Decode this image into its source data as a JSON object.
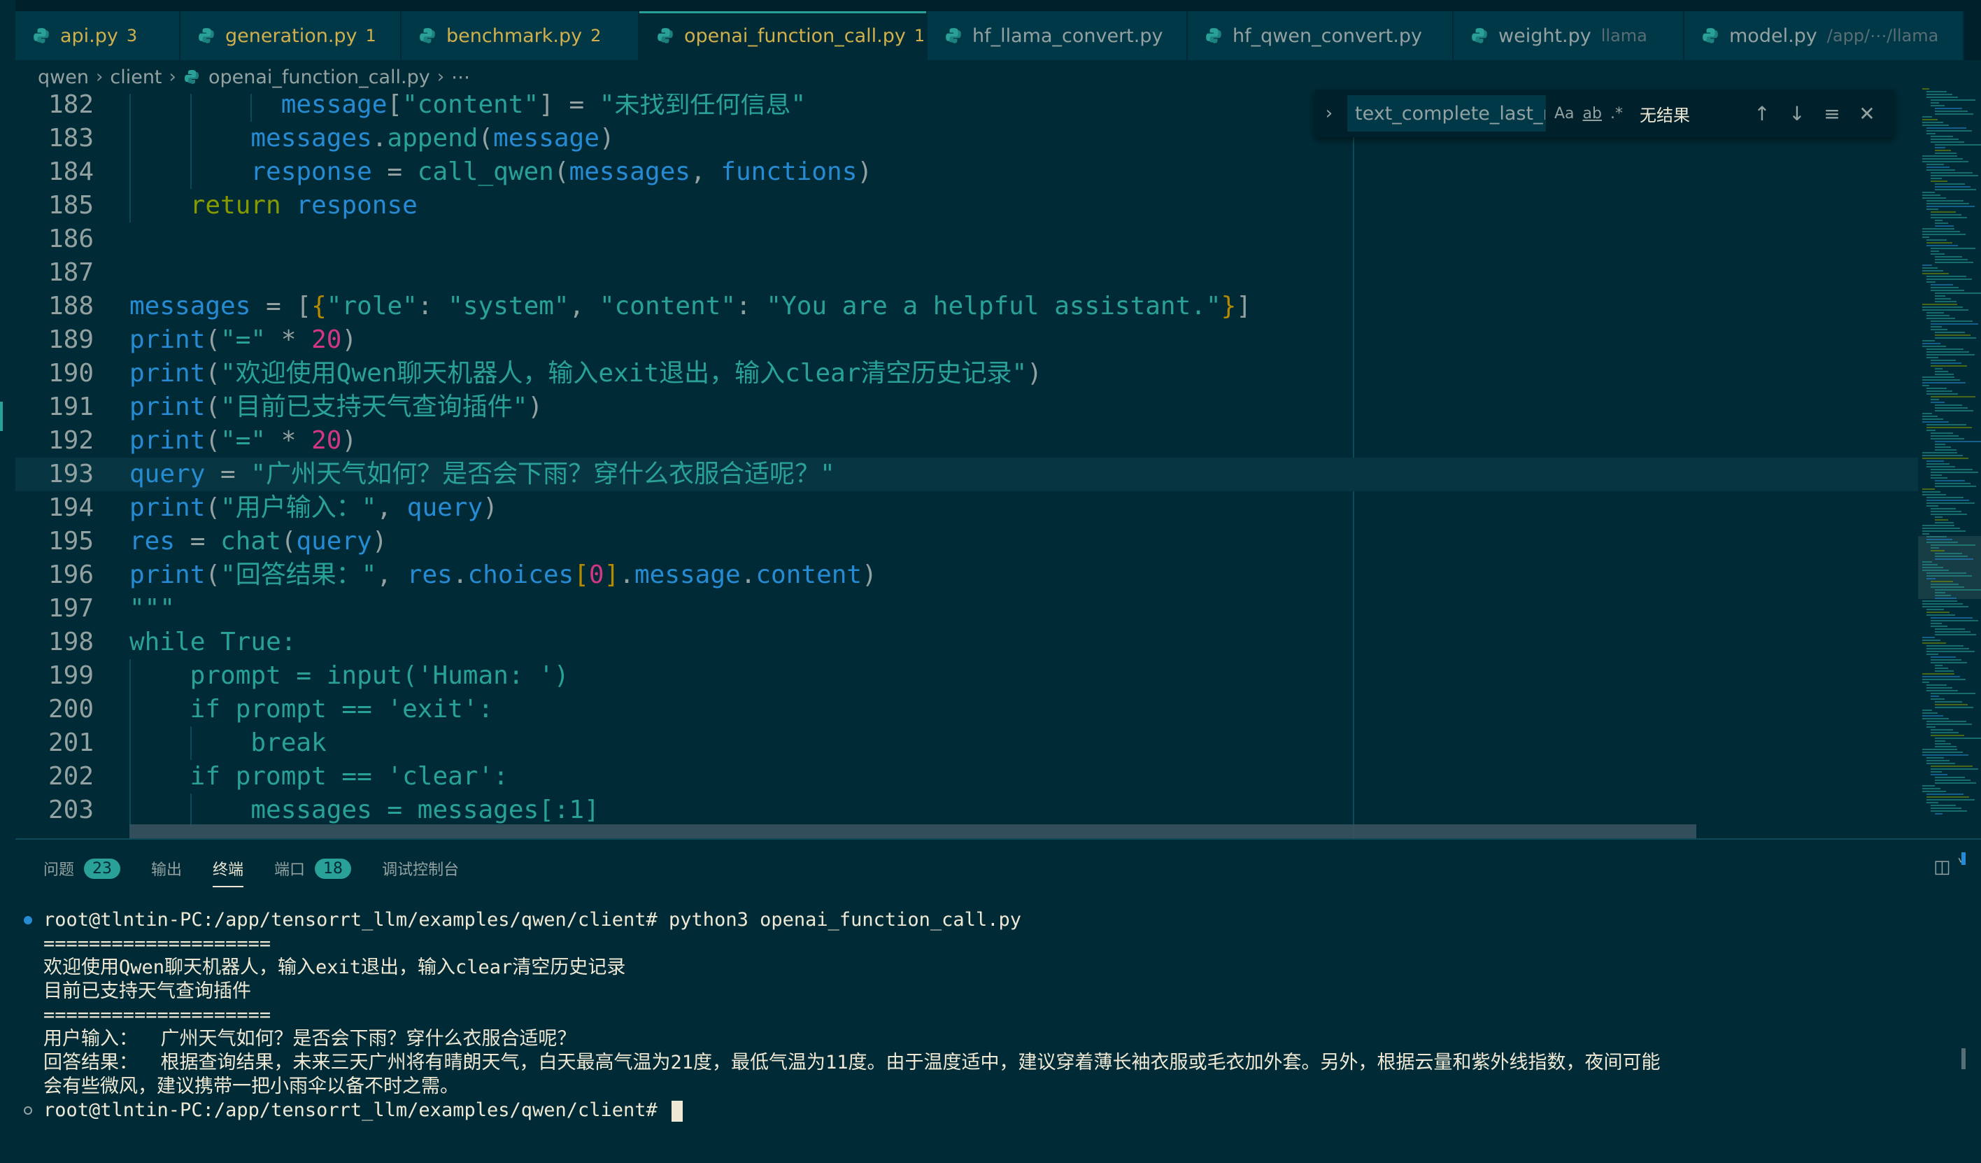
{
  "tabs": [
    {
      "label": "api.py",
      "badge": "3",
      "desc": "",
      "active": false
    },
    {
      "label": "generation.py",
      "badge": "1",
      "desc": "",
      "active": false
    },
    {
      "label": "benchmark.py",
      "badge": "2",
      "desc": "",
      "active": false
    },
    {
      "label": "openai_function_call.py",
      "badge": "1",
      "desc": "",
      "active": true
    },
    {
      "label": "hf_llama_convert.py",
      "badge": "",
      "desc": "",
      "active": false
    },
    {
      "label": "hf_qwen_convert.py",
      "badge": "",
      "desc": "",
      "active": false
    },
    {
      "label": "weight.py",
      "badge": "",
      "desc": "llama",
      "active": false
    },
    {
      "label": "model.py",
      "badge": "",
      "desc": "/app/⋯/llama",
      "active": false
    }
  ],
  "close_glyph": "✕",
  "breadcrumb": {
    "items": [
      "qwen",
      "client",
      "openai_function_call.py"
    ],
    "more": "⋯"
  },
  "find": {
    "query": "text_complete_last_m",
    "match_case": "Aa",
    "whole_word": "ab",
    "regex": ".*",
    "results": "无结果"
  },
  "editor": {
    "lines": [
      {
        "n": "182",
        "tokens": [
          [
            "message",
            "t-var"
          ],
          [
            "[",
            "t-punct"
          ],
          [
            "\"content\"",
            "t-str"
          ],
          [
            "] = ",
            "t-punct"
          ],
          [
            "\"未找到任何信息\"",
            "t-str"
          ]
        ],
        "indent": 10
      },
      {
        "n": "183",
        "tokens": [
          [
            "messages",
            "t-var"
          ],
          [
            ".",
            "t-punct"
          ],
          [
            "append",
            "t-def"
          ],
          [
            "(",
            "t-punct"
          ],
          [
            "message",
            "t-var"
          ],
          [
            ")",
            "t-punct"
          ]
        ],
        "indent": 8
      },
      {
        "n": "184",
        "tokens": [
          [
            "response",
            "t-var"
          ],
          [
            " = ",
            "t-punct"
          ],
          [
            "call_qwen",
            "t-def"
          ],
          [
            "(",
            "t-punct"
          ],
          [
            "messages",
            "t-var"
          ],
          [
            ", ",
            "t-punct"
          ],
          [
            "functions",
            "t-var"
          ],
          [
            ")",
            "t-punct"
          ]
        ],
        "indent": 8
      },
      {
        "n": "185",
        "tokens": [
          [
            "return",
            "t-kw"
          ],
          [
            " ",
            "t-punct"
          ],
          [
            "response",
            "t-var"
          ]
        ],
        "indent": 4
      },
      {
        "n": "186",
        "tokens": [],
        "indent": 0
      },
      {
        "n": "187",
        "tokens": [],
        "indent": 0
      },
      {
        "n": "188",
        "tokens": [
          [
            "messages",
            "t-var"
          ],
          [
            " = ",
            "t-punct"
          ],
          [
            "[",
            "t-punct"
          ],
          [
            "{",
            "t-br"
          ],
          [
            "\"role\"",
            "t-str"
          ],
          [
            ": ",
            "t-punct"
          ],
          [
            "\"system\"",
            "t-str"
          ],
          [
            ", ",
            "t-punct"
          ],
          [
            "\"content\"",
            "t-str"
          ],
          [
            ": ",
            "t-punct"
          ],
          [
            "\"You are a helpful assistant.\"",
            "t-str"
          ],
          [
            "}",
            "t-br"
          ],
          [
            "]",
            "t-punct"
          ]
        ],
        "indent": 0
      },
      {
        "n": "189",
        "tokens": [
          [
            "print",
            "t-var"
          ],
          [
            "(",
            "t-punct"
          ],
          [
            "\"=\"",
            "t-str"
          ],
          [
            " * ",
            "t-punct"
          ],
          [
            "20",
            "t-num"
          ],
          [
            ")",
            "t-punct"
          ]
        ],
        "indent": 0
      },
      {
        "n": "190",
        "tokens": [
          [
            "print",
            "t-var"
          ],
          [
            "(",
            "t-punct"
          ],
          [
            "\"欢迎使用Qwen聊天机器人，输入exit退出，输入clear清空历史记录\"",
            "t-str"
          ],
          [
            ")",
            "t-punct"
          ]
        ],
        "indent": 0
      },
      {
        "n": "191",
        "tokens": [
          [
            "print",
            "t-var"
          ],
          [
            "(",
            "t-punct"
          ],
          [
            "\"目前已支持天气查询插件\"",
            "t-str"
          ],
          [
            ")",
            "t-punct"
          ]
        ],
        "indent": 0
      },
      {
        "n": "192",
        "tokens": [
          [
            "print",
            "t-var"
          ],
          [
            "(",
            "t-punct"
          ],
          [
            "\"=\"",
            "t-str"
          ],
          [
            " * ",
            "t-punct"
          ],
          [
            "20",
            "t-num"
          ],
          [
            ")",
            "t-punct"
          ]
        ],
        "indent": 0
      },
      {
        "n": "193",
        "tokens": [
          [
            "query",
            "t-var"
          ],
          [
            " = ",
            "t-punct"
          ],
          [
            "\"广州天气如何？是否会下雨？穿什么衣服合适呢？\"",
            "t-str"
          ]
        ],
        "indent": 0,
        "current": true
      },
      {
        "n": "194",
        "tokens": [
          [
            "print",
            "t-var"
          ],
          [
            "(",
            "t-punct"
          ],
          [
            "\"用户输入：\"",
            "t-str"
          ],
          [
            ", ",
            "t-punct"
          ],
          [
            "query",
            "t-var"
          ],
          [
            ")",
            "t-punct"
          ]
        ],
        "indent": 0
      },
      {
        "n": "195",
        "tokens": [
          [
            "res",
            "t-var"
          ],
          [
            " = ",
            "t-punct"
          ],
          [
            "chat",
            "t-def"
          ],
          [
            "(",
            "t-punct"
          ],
          [
            "query",
            "t-var"
          ],
          [
            ")",
            "t-punct"
          ]
        ],
        "indent": 0
      },
      {
        "n": "196",
        "tokens": [
          [
            "print",
            "t-var"
          ],
          [
            "(",
            "t-punct"
          ],
          [
            "\"回答结果：\"",
            "t-str"
          ],
          [
            ", ",
            "t-punct"
          ],
          [
            "res",
            "t-var"
          ],
          [
            ".",
            "t-punct"
          ],
          [
            "choices",
            "t-var"
          ],
          [
            "[",
            "t-br"
          ],
          [
            "0",
            "t-num"
          ],
          [
            "]",
            "t-br"
          ],
          [
            ".",
            "t-punct"
          ],
          [
            "message",
            "t-var"
          ],
          [
            ".",
            "t-punct"
          ],
          [
            "content",
            "t-var"
          ],
          [
            ")",
            "t-punct"
          ]
        ],
        "indent": 0
      },
      {
        "n": "197",
        "tokens": [
          [
            "\"\"\"",
            "t-str"
          ]
        ],
        "indent": 0
      },
      {
        "n": "198",
        "tokens": [
          [
            "while True:",
            "t-str"
          ]
        ],
        "indent": 0
      },
      {
        "n": "199",
        "tokens": [
          [
            "prompt = input('Human: ')",
            "t-str"
          ]
        ],
        "indent": 4
      },
      {
        "n": "200",
        "tokens": [
          [
            "if prompt == 'exit':",
            "t-str"
          ]
        ],
        "indent": 4
      },
      {
        "n": "201",
        "tokens": [
          [
            "break",
            "t-str"
          ]
        ],
        "indent": 8
      },
      {
        "n": "202",
        "tokens": [
          [
            "if prompt == 'clear':",
            "t-str"
          ]
        ],
        "indent": 4
      },
      {
        "n": "203",
        "tokens": [
          [
            "messages = messages[:1]",
            "t-str"
          ]
        ],
        "indent": 8
      }
    ]
  },
  "panel": {
    "tabs": [
      {
        "label": "问题",
        "badge": "23",
        "active": false
      },
      {
        "label": "输出",
        "badge": "",
        "active": false
      },
      {
        "label": "终端",
        "badge": "",
        "active": true
      },
      {
        "label": "端口",
        "badge": "18",
        "active": false
      },
      {
        "label": "调试控制台",
        "badge": "",
        "active": false
      }
    ],
    "actions": "◫ ˅"
  },
  "terminal": {
    "lines": [
      "root@tlntin-PC:/app/tensorrt_llm/examples/qwen/client# python3 openai_function_call.py",
      "====================",
      "欢迎使用Qwen聊天机器人，输入exit退出，输入clear清空历史记录",
      "目前已支持天气查询插件",
      "====================",
      "用户输入：  广州天气如何？是否会下雨？穿什么衣服合适呢？",
      "回答结果：  根据查询结果，未来三天广州将有晴朗天气，白天最高气温为21度，最低气温为11度。由于温度适中，建议穿着薄长袖衣服或毛衣加外套。另外，根据云量和紫外线指数，夜间可能",
      "会有些微风，建议携带一把小雨伞以备不时之需。",
      "root@tlntin-PC:/app/tensorrt_llm/examples/qwen/client# "
    ]
  },
  "colors": {
    "background": "#002b36",
    "accent": "#2aa198",
    "tab_label": "#d1b04c"
  }
}
